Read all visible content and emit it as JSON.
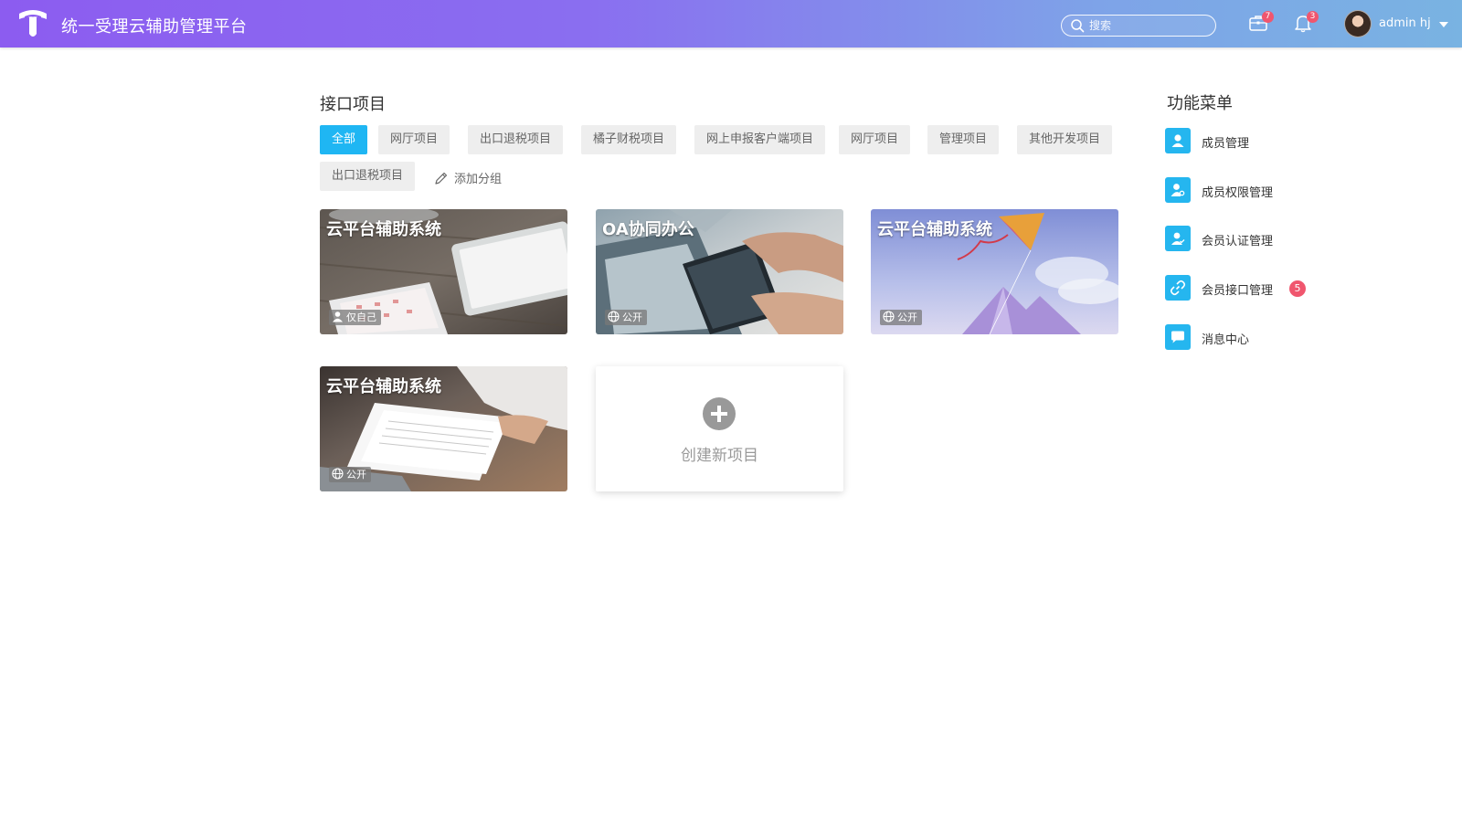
{
  "header": {
    "app_title": "统一受理云辅助管理平台",
    "search_placeholder": "搜索",
    "briefcase_count": "7",
    "notification_count": "3",
    "username": "admin hj"
  },
  "projects": {
    "section_title": "接口项目",
    "tags": [
      {
        "label": "全部",
        "active": true
      },
      {
        "label": "网厅项目"
      },
      {
        "label": "出口退税项目"
      },
      {
        "label": "橘子财税项目"
      },
      {
        "label": "网上申报客户端项目"
      },
      {
        "label": "网厅项目"
      },
      {
        "label": "管理项目"
      },
      {
        "label": "其他开发项目"
      },
      {
        "label": "出口退税项目"
      }
    ],
    "add_group_label": "添加分组",
    "cards": [
      {
        "title": "云平台辅助系统",
        "visibility": "仅自己",
        "visibility_icon": "user-icon"
      },
      {
        "title": "OA协同办公",
        "visibility": "公开",
        "visibility_icon": "globe-icon"
      },
      {
        "title": "云平台辅助系统",
        "visibility": "公开",
        "visibility_icon": "globe-icon"
      },
      {
        "title": "云平台辅助系统",
        "visibility": "公开",
        "visibility_icon": "globe-icon"
      }
    ],
    "new_project_label": "创建新项目"
  },
  "menu": {
    "title": "功能菜单",
    "items": [
      {
        "label": "成员管理",
        "icon": "member-icon"
      },
      {
        "label": "成员权限管理",
        "icon": "permission-icon"
      },
      {
        "label": "会员认证管理",
        "icon": "verify-icon"
      },
      {
        "label": "会员接口管理",
        "icon": "link-icon",
        "badge": "5"
      },
      {
        "label": "消息中心",
        "icon": "message-icon"
      }
    ]
  },
  "colors": {
    "accent": "#1fb6f3",
    "badge": "#f0566e",
    "header_gradient_start": "#8c5cf0",
    "header_gradient_end": "#79b3e2"
  }
}
